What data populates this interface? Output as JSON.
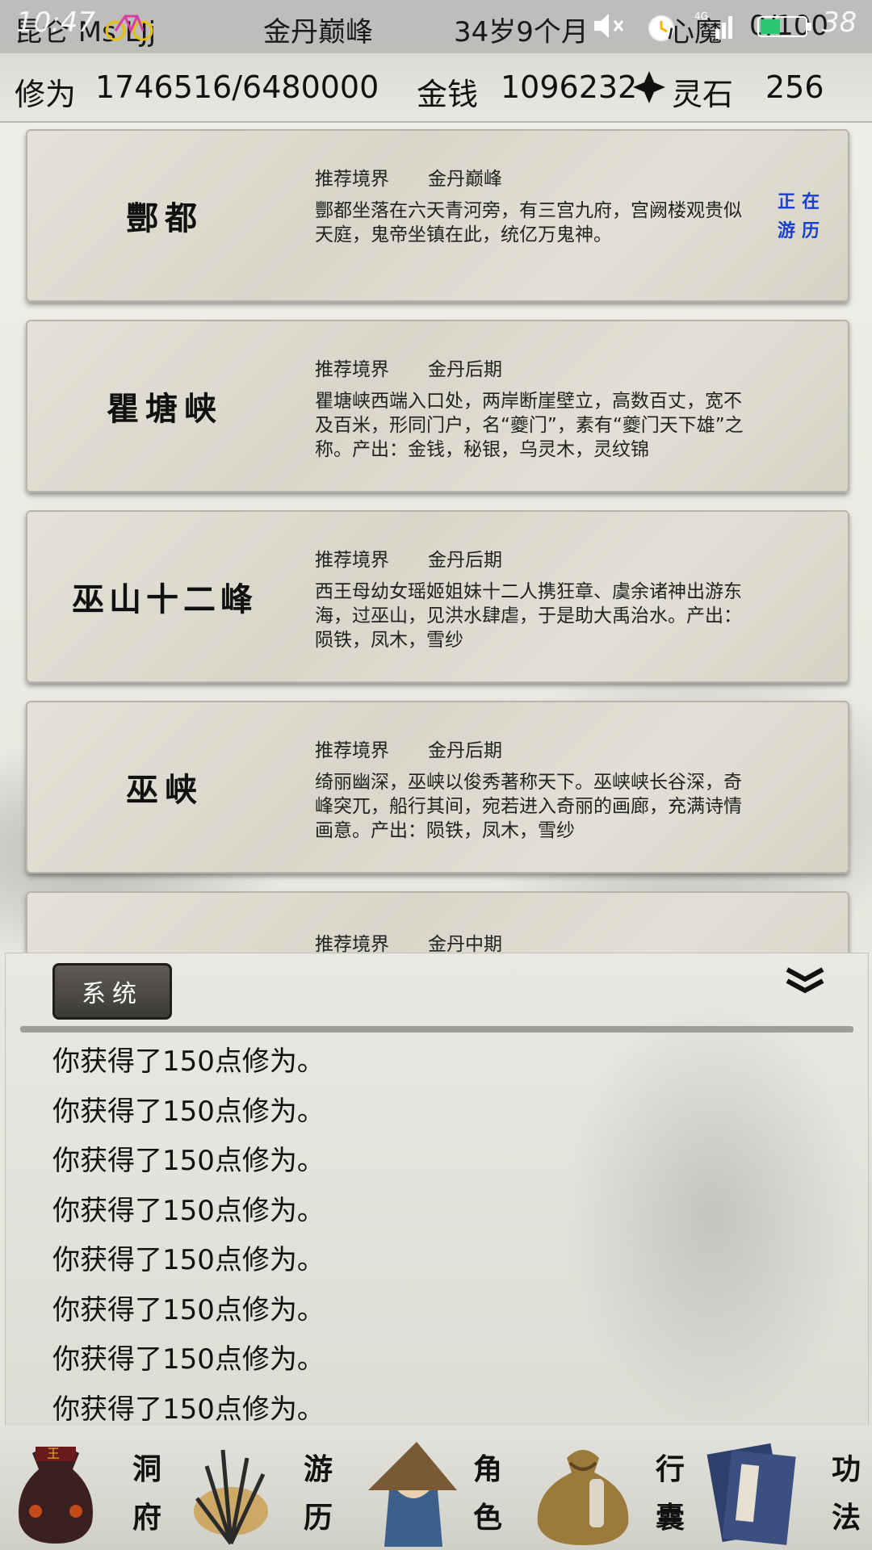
{
  "status_bar": {
    "time": "10:47",
    "left_text": "昆仑 Ms  LJj",
    "signal": "4G",
    "battery": "38"
  },
  "header": {
    "realm": "金丹巅峰",
    "age": "34岁9个月",
    "heart_demon_label": "心魔",
    "heart_demon_value": "0/100",
    "cultivation_label": "修为",
    "cultivation_value": "1746516/6480000",
    "money_label": "金钱",
    "money_value": "1096232",
    "spirit_stone_label": "灵石",
    "spirit_stone_value": "256"
  },
  "locations": [
    {
      "name": "酆都",
      "rec_label": "推荐境界",
      "rec_value": "金丹巅峰",
      "desc": "酆都坐落在六天青河旁，有三宫九府，宫阙楼观贵似天庭，鬼帝坐镇在此，统亿万鬼神。",
      "flag": "正在游历"
    },
    {
      "name": "瞿塘峡",
      "rec_label": "推荐境界",
      "rec_value": "金丹后期",
      "desc": "瞿塘峡西端入口处，两岸断崖壁立，高数百丈，宽不及百米，形同门户，名“夔门”，素有“夔门天下雄”之称。产出：金钱，秘银，乌灵木，灵纹锦"
    },
    {
      "name": "巫山十二峰",
      "rec_label": "推荐境界",
      "rec_value": "金丹后期",
      "desc": "西王母幼女瑶姬姐妹十二人携狂章、虞余诸神出游东海，过巫山，见洪水肆虐，于是助大禹治水。产出：陨铁，凤木，雪纱"
    },
    {
      "name": "巫峡",
      "rec_label": "推荐境界",
      "rec_value": "金丹后期",
      "desc": "绮丽幽深，巫峡以俊秀著称天下。巫峡峡长谷深，奇峰突兀，船行其间，宛若进入奇丽的画廊，充满诗情画意。产出：陨铁，凤木，雪纱"
    },
    {
      "name": "",
      "rec_label": "推荐境界",
      "rec_value": "金丹中期",
      "desc": ""
    }
  ],
  "log": {
    "tab_label": "系统",
    "lines": [
      "你获得了150点修为。",
      "你获得了150点修为。",
      "你获得了150点修为。",
      "你获得了150点修为。",
      "你获得了150点修为。",
      "你获得了150点修为。",
      "你获得了150点修为。",
      "你获得了150点修为。"
    ]
  },
  "nav": [
    {
      "label_1": "洞",
      "label_2": "府",
      "icon": "pouch-icon"
    },
    {
      "label_1": "游",
      "label_2": "历",
      "icon": "grass-icon"
    },
    {
      "label_1": "角",
      "label_2": "色",
      "icon": "straw-hat-icon"
    },
    {
      "label_1": "行",
      "label_2": "囊",
      "icon": "bag-icon"
    },
    {
      "label_1": "功",
      "label_2": "法",
      "icon": "book-icon"
    }
  ],
  "colors": {
    "flag_blue": "#1a3fd1",
    "tab_dark": "#3c3a36"
  }
}
